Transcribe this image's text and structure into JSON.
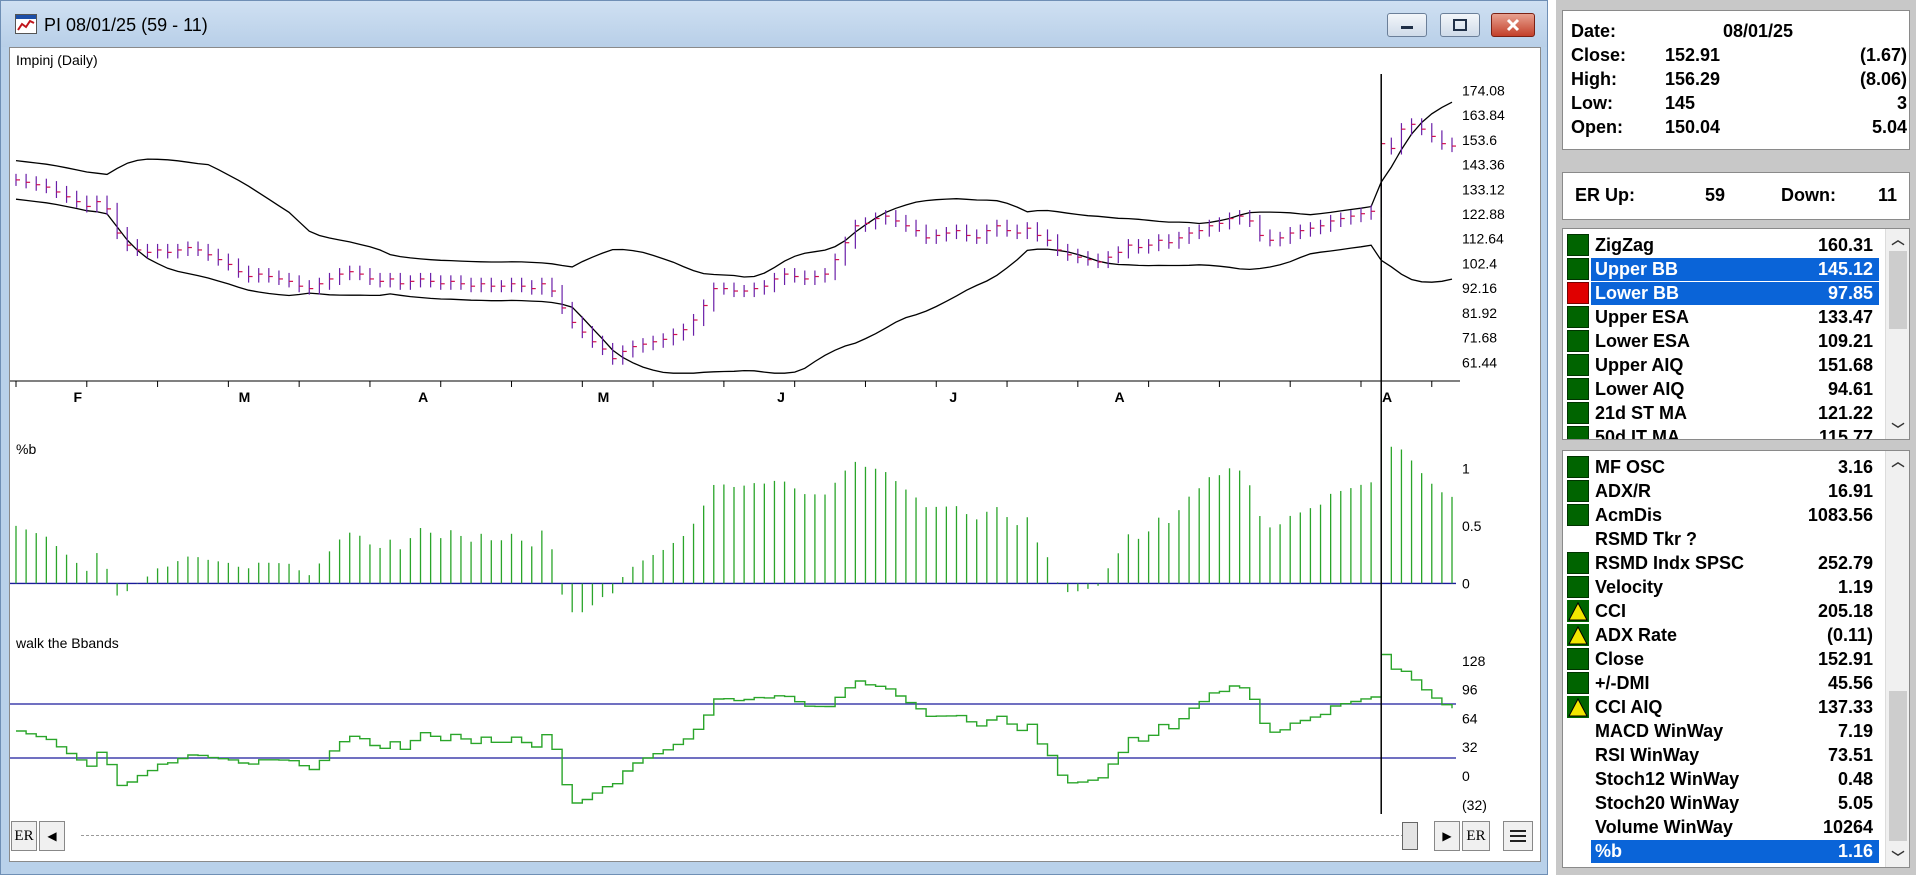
{
  "window": {
    "title": "PI 08/01/25 (59 - 11)"
  },
  "panes": {
    "price_label": "Impinj (Daily)",
    "pctb_label": "%b",
    "walk_label": "walk the Bbands"
  },
  "scroll": {
    "left_er": "ER",
    "right_er": "ER",
    "left_arrow": "◀",
    "right_arrow": "▶"
  },
  "info": {
    "quote": [
      {
        "label": "Date:",
        "value": "08/01/25",
        "change": ""
      },
      {
        "label": "Close:",
        "value": "152.91",
        "change": "(1.67)"
      },
      {
        "label": "High:",
        "value": "156.29",
        "change": "(8.06)"
      },
      {
        "label": "Low:",
        "value": "145",
        "change": "3"
      },
      {
        "label": "Open:",
        "value": "150.04",
        "change": "5.04"
      }
    ],
    "er": {
      "up_label": "ER Up:",
      "up_value": "59",
      "down_label": "Down:",
      "down_value": "11"
    },
    "indicators": [
      {
        "label": "ZigZag",
        "value": "160.31",
        "marker": "green",
        "selected": false
      },
      {
        "label": "Upper BB",
        "value": "145.12",
        "marker": "green",
        "selected": true
      },
      {
        "label": "Lower BB",
        "value": "97.85",
        "marker": "red",
        "selected": true
      },
      {
        "label": "Upper ESA",
        "value": "133.47",
        "marker": "green",
        "selected": false
      },
      {
        "label": "Lower ESA",
        "value": "109.21",
        "marker": "green",
        "selected": false
      },
      {
        "label": "Upper AIQ",
        "value": "151.68",
        "marker": "green",
        "selected": false
      },
      {
        "label": "Lower AIQ",
        "value": "94.61",
        "marker": "green",
        "selected": false
      },
      {
        "label": "21d ST MA",
        "value": "121.22",
        "marker": "green",
        "selected": false
      },
      {
        "label": "50d IT MA",
        "value": "115.77",
        "marker": "green",
        "selected": false
      }
    ],
    "indicators2": [
      {
        "label": "MF OSC",
        "value": "3.16",
        "marker": "green",
        "selected": false
      },
      {
        "label": "ADX/R",
        "value": "16.91",
        "marker": "green",
        "selected": false
      },
      {
        "label": "AcmDis",
        "value": "1083.56",
        "marker": "green",
        "selected": false
      },
      {
        "label": "RSMD Tkr ?",
        "value": "",
        "marker": "none",
        "selected": false
      },
      {
        "label": "RSMD Indx SPSC",
        "value": "252.79",
        "marker": "green",
        "selected": false
      },
      {
        "label": "Velocity",
        "value": "1.19",
        "marker": "green",
        "selected": false
      },
      {
        "label": "CCI",
        "value": "205.18",
        "marker": "up",
        "selected": false
      },
      {
        "label": "ADX Rate",
        "value": "(0.11)",
        "marker": "up",
        "selected": false
      },
      {
        "label": "Close",
        "value": "152.91",
        "marker": "green",
        "selected": false
      },
      {
        "label": "+/-DMI",
        "value": "45.56",
        "marker": "green",
        "selected": false
      },
      {
        "label": "CCI AIQ",
        "value": "137.33",
        "marker": "up",
        "selected": false
      },
      {
        "label": "MACD WinWay",
        "value": "7.19",
        "marker": "none",
        "selected": false
      },
      {
        "label": "RSI WinWay",
        "value": "73.51",
        "marker": "none",
        "selected": false
      },
      {
        "label": "Stoch12 WinWay",
        "value": "0.48",
        "marker": "none",
        "selected": false
      },
      {
        "label": "Stoch20 WinWay",
        "value": "5.05",
        "marker": "none",
        "selected": false
      },
      {
        "label": "Volume WinWay",
        "value": "10264",
        "marker": "none",
        "selected": false
      },
      {
        "label": "%b",
        "value": "1.16",
        "marker": "none",
        "selected": true
      }
    ]
  },
  "colors": {
    "bars": "#6a1fa8",
    "band_line": "#000000",
    "pctb": "#2aa52a",
    "walk": "#2aa52a",
    "ref_line": "#1a1a9c",
    "selection": "#0a64d8"
  },
  "chart_data": {
    "price": {
      "type": "ohlc",
      "yticks": [
        "174.08",
        "163.84",
        "153.6",
        "143.36",
        "133.12",
        "122.88",
        "112.64",
        "102.4",
        "92.16",
        "81.92",
        "71.68",
        "61.44"
      ],
      "ylim": [
        55,
        180
      ],
      "months": [
        "F",
        "M",
        "A",
        "M",
        "J",
        "J",
        "A",
        "A"
      ],
      "closes": [
        137,
        136,
        135,
        134,
        132,
        130,
        128,
        126,
        128,
        125,
        115,
        110,
        108,
        107,
        108,
        107,
        108,
        109,
        108,
        106,
        104,
        102,
        99,
        97,
        98,
        97,
        96,
        95,
        93,
        92,
        94,
        96,
        98,
        99,
        98,
        96,
        95,
        96,
        94,
        95,
        96,
        95,
        94,
        95,
        94,
        93,
        94,
        93,
        93,
        94,
        93,
        92,
        94,
        91,
        84,
        78,
        74,
        70,
        67,
        63,
        66,
        68,
        69,
        70,
        71,
        73,
        75,
        79,
        85,
        92,
        92,
        91,
        91,
        92,
        93,
        96,
        98,
        97,
        96,
        97,
        98,
        104,
        111,
        118,
        119,
        121,
        122,
        120,
        118,
        116,
        113,
        114,
        115,
        116,
        114,
        113,
        116,
        118,
        116,
        115,
        117,
        114,
        112,
        108,
        106,
        105,
        104,
        103,
        105,
        107,
        110,
        109,
        110,
        112,
        111,
        113,
        115,
        116,
        118,
        119,
        121,
        122,
        120,
        114,
        112,
        113,
        115,
        116,
        117,
        118,
        120,
        121,
        122,
        123,
        124,
        152,
        150,
        158,
        160,
        158,
        155,
        152,
        151
      ]
    },
    "pctb": {
      "type": "bar",
      "yticks": [
        "1",
        "0.5",
        "0"
      ],
      "ylim": [
        -0.3,
        1.35
      ]
    },
    "walk": {
      "type": "line",
      "yticks": [
        "128",
        "96",
        "64",
        "32",
        "0",
        "(32)"
      ],
      "ylim": [
        -40,
        140
      ],
      "ref_lines": [
        80,
        20
      ]
    }
  }
}
